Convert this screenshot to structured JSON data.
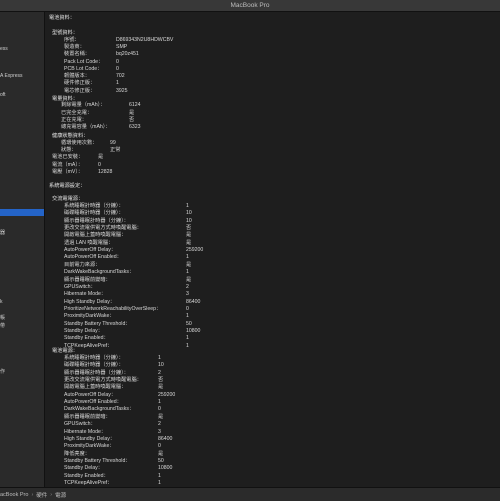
{
  "window": {
    "title": "MacBook Pro"
  },
  "sidebar": {
    "items": [
      "ess",
      "A Express",
      "oft",
      "器",
      "k",
      "帳",
      "帶",
      "作"
    ]
  },
  "content": {
    "battery_section": "電池資料：",
    "model_info": "型號資料：",
    "serial_label": "序號：",
    "serial_value": "D869343N2U8HDWCBV",
    "manufacturer_label": "製造商：",
    "manufacturer_value": "SMP",
    "device_name_label": "裝置名稱：",
    "device_name_value": "bq20z451",
    "pack_lot_label": "Pack Lot Code：",
    "pack_lot_value": "0",
    "pcb_lot_label": "PCB Lot Code：",
    "pcb_lot_value": "0",
    "firmware_label": "韌體版本：",
    "firmware_value": "702",
    "hw_rev_label": "硬件修正版：",
    "hw_rev_value": "1",
    "cell_rev_label": "電芯修正版：",
    "cell_rev_value": "3925",
    "charge_info": "電量資料：",
    "remaining_label": "剩餘電量（mAh）：",
    "remaining_value": "6124",
    "fully_charged_label": "已完全充電：",
    "fully_charged_value": "是",
    "charging_label": "正在充電：",
    "charging_value": "否",
    "full_capacity_label": "總充電容量（mAh）：",
    "full_capacity_value": "6323",
    "health_info": "健康狀態資料：",
    "cycle_label": "循環使用次數：",
    "cycle_value": "99",
    "condition_label": "狀態：",
    "condition_value": "正常",
    "installed_label": "電池已安裝：",
    "installed_value": "是",
    "amperage_label": "電流（mA）：",
    "amperage_value": "0",
    "voltage_label": "電壓（mV）：",
    "voltage_value": "12828",
    "power_settings": "系統電源設定：",
    "ac_power": "交流電電源：",
    "ac": [
      [
        "系統睡眠計時器（分鐘）：",
        "1"
      ],
      [
        "磁碟睡眠計時器（分鐘）：",
        "10"
      ],
      [
        "顯示器睡眠計時器（分鐘）：",
        "10"
      ],
      [
        "更改交流電供電方式時喚醒電腦：",
        "否"
      ],
      [
        "開啟電腦上蓋時喚醒電腦：",
        "是"
      ],
      [
        "透過 LAN 喚醒電腦：",
        "是"
      ],
      [
        "AutoPowerOff Delay：",
        "259200"
      ],
      [
        "AutoPowerOff Enabled：",
        "1"
      ],
      [
        "目前電力來源：",
        "是"
      ],
      [
        "DarkWakeBackgroundTasks：",
        "1"
      ],
      [
        "顯示器睡眠前變暗：",
        "是"
      ],
      [
        "GPUSwitch：",
        "2"
      ],
      [
        "Hibernate Mode：",
        "3"
      ],
      [
        "High Standby Delay：",
        "86400"
      ],
      [
        "PrioritizeNetworkReachabilityOverSleep：",
        "0"
      ],
      [
        "ProximityDarkWake：",
        "1"
      ],
      [
        "Standby Battery Threshold：",
        "50"
      ],
      [
        "Standby Delay：",
        "10800"
      ],
      [
        "Standby Enabled：",
        "1"
      ],
      [
        "TCPKeepAlivePref：",
        "1"
      ]
    ],
    "battery_power": "電池電源：",
    "battery": [
      [
        "系統睡眠計時器（分鐘）：",
        "1"
      ],
      [
        "磁碟睡眠計時器（分鐘）：",
        "10"
      ],
      [
        "顯示器睡眠計時器（分鐘）：",
        "2"
      ],
      [
        "更改交流電供電方式時喚醒電腦：",
        "否"
      ],
      [
        "開啟電腦上蓋時喚醒電腦：",
        "是"
      ],
      [
        "AutoPowerOff Delay：",
        "259200"
      ],
      [
        "AutoPowerOff Enabled：",
        "1"
      ],
      [
        "DarkWakeBackgroundTasks：",
        "0"
      ],
      [
        "顯示器睡眠前變暗：",
        "是"
      ],
      [
        "GPUSwitch：",
        "2"
      ],
      [
        "Hibernate Mode：",
        "3"
      ],
      [
        "High Standby Delay：",
        "86400"
      ],
      [
        "ProximityDarkWake：",
        "0"
      ],
      [
        "降低亮度：",
        "是"
      ],
      [
        "Standby Battery Threshold：",
        "50"
      ],
      [
        "Standby Delay：",
        "10800"
      ],
      [
        "Standby Enabled：",
        "1"
      ],
      [
        "TCPKeepAlivePref：",
        "1"
      ]
    ]
  },
  "statusbar": {
    "path1": "acBook Pro",
    "sep1": "›",
    "path2": "硬件",
    "sep2": "›",
    "path3": "電源"
  }
}
